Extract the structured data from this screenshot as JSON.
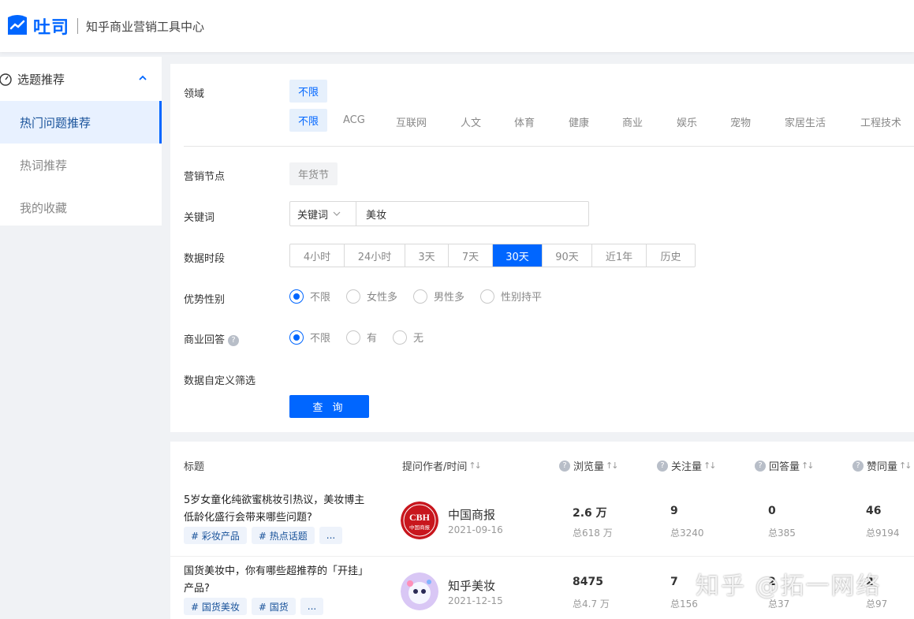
{
  "header": {
    "logo_text": "吐司",
    "subtitle": "知乎商业营销工具中心"
  },
  "sidebar": {
    "group_label": "选题推荐",
    "items": [
      {
        "label": "热门问题推荐",
        "active": true
      },
      {
        "label": "热词推荐",
        "active": false
      },
      {
        "label": "我的收藏",
        "active": false
      }
    ]
  },
  "filters": {
    "domain": {
      "label": "领域",
      "selected_chip": "不限",
      "categories": [
        "不限",
        "ACG",
        "互联网",
        "人文",
        "体育",
        "健康",
        "商业",
        "娱乐",
        "宠物",
        "家居生活",
        "工程技术"
      ]
    },
    "marketing_node": {
      "label": "营销节点",
      "chip": "年货节"
    },
    "keyword": {
      "label": "关键词",
      "select_value": "关键词",
      "input_value": "美妆"
    },
    "period": {
      "label": "数据时段",
      "options": [
        "4小时",
        "24小时",
        "3天",
        "7天",
        "30天",
        "90天",
        "近1年",
        "历史"
      ],
      "selected": "30天"
    },
    "gender": {
      "label": "优势性别",
      "options": [
        "不限",
        "女性多",
        "男性多",
        "性别持平"
      ],
      "selected": "不限"
    },
    "business_answer": {
      "label": "商业回答",
      "options": [
        "不限",
        "有",
        "无"
      ],
      "selected": "不限"
    },
    "custom_filter": {
      "label": "数据自定义筛选"
    },
    "query_button": "查 询"
  },
  "table": {
    "headers": {
      "title": "标题",
      "author_time": "提问作者/时间",
      "views": "浏览量",
      "follows": "关注量",
      "answers": "回答量",
      "likes": "赞同量"
    },
    "rows": [
      {
        "title": "5岁女童化纯欲蜜桃妆引热议，美妆博主低龄化盛行会带来哪些问题?",
        "tags": [
          "# 彩妆产品",
          "# 热点话题",
          "..."
        ],
        "author": "中国商报",
        "avatar_text": "CBH",
        "avatar_sub": "中国商报",
        "date": "2021-09-16",
        "views": "2.6 万",
        "views_total": "总618 万",
        "follows": "9",
        "follows_total": "总3240",
        "answers": "0",
        "answers_total": "总385",
        "likes": "46",
        "likes_total": "总9194"
      },
      {
        "title": "国货美妆中，你有哪些超推荐的「开挂」产品?",
        "tags": [
          "# 国货美妆",
          "# 国货",
          "..."
        ],
        "author": "知乎美妆",
        "date": "2021-12-15",
        "views": "8475",
        "views_total": "总4.7 万",
        "follows": "7",
        "follows_total": "总156",
        "answers": "2",
        "answers_total": "总37",
        "likes": "2",
        "likes_total": "总97"
      }
    ]
  },
  "watermark": "知乎 @拓一网络",
  "colors": {
    "accent": "#0066ff",
    "link": "#175199",
    "background": "#f0f2f5"
  }
}
